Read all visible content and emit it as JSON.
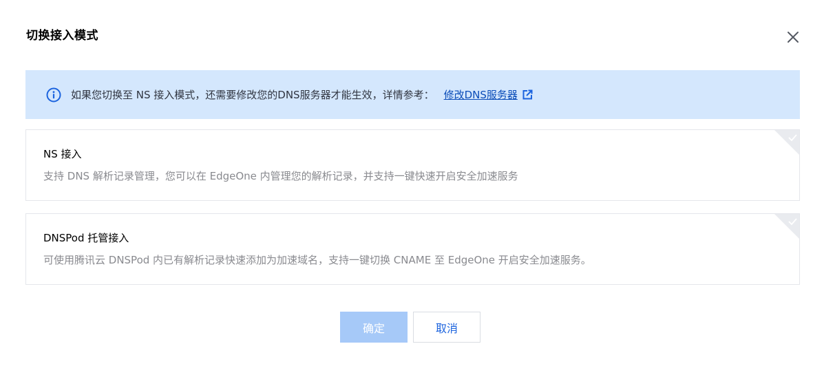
{
  "dialog": {
    "title": "切换接入模式"
  },
  "info": {
    "text": "如果您切换至 NS 接入模式，还需要修改您的DNS服务器才能生效，详情参考：",
    "link": "修改DNS服务器"
  },
  "options": [
    {
      "title": "NS 接入",
      "desc": "支持 DNS 解析记录管理，您可以在 EdgeOne 内管理您的解析记录，并支持一键快速开启安全加速服务"
    },
    {
      "title": "DNSPod 托管接入",
      "desc": "可使用腾讯云 DNSPod 内已有解析记录快速添加为加速域名，支持一键切换 CNAME 至 EdgeOne 开启安全加速服务。"
    }
  ],
  "buttons": {
    "confirm": "确定",
    "cancel": "取消"
  },
  "colors": {
    "info_background": "#d4e7fd",
    "link": "#0a4cb8",
    "confirm_disabled": "#a6c9f8",
    "primary": "#1b63de"
  },
  "icons": {
    "close": "close-icon",
    "info": "info-circle-icon",
    "external_link": "external-link-icon",
    "corner_check": "check-icon"
  }
}
